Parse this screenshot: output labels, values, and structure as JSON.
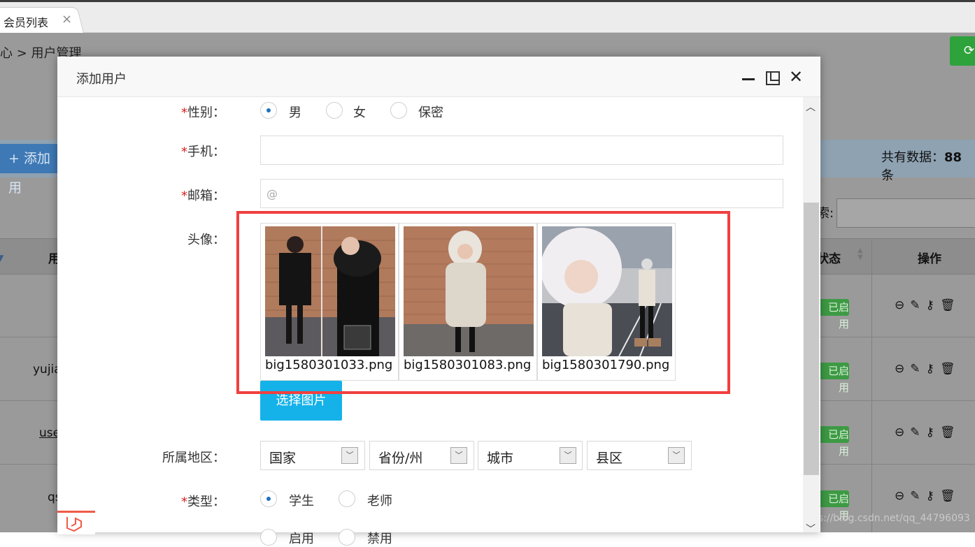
{
  "tab": {
    "label": "会员列表",
    "close": "×"
  },
  "breadcrumb": "心 > 用户管理",
  "toolbar": {
    "add_label": "+ 添加用",
    "total_prefix": "共有数据：",
    "total_count": "88",
    "total_suffix": " 条",
    "search_label": "索:"
  },
  "table": {
    "headers": {
      "user": "用",
      "status": "状态",
      "actions": "操作"
    },
    "rows": [
      {
        "name": "",
        "status": "已启用"
      },
      {
        "name": "yujia",
        "status": "已启用"
      },
      {
        "name": "use",
        "status": "已启用"
      },
      {
        "name": "qs",
        "status": "已启用"
      }
    ],
    "action_icons": [
      "stop-icon",
      "edit-icon",
      "key-icon",
      "trash-icon"
    ]
  },
  "watermark": "https://blog.csdn.net/qq_44796093",
  "modal": {
    "title": "添加用户",
    "gender": {
      "label": "性别：",
      "options": [
        "男",
        "女",
        "保密"
      ],
      "selected": "男"
    },
    "phone": {
      "label": "手机：",
      "value": ""
    },
    "email": {
      "label": "邮箱：",
      "placeholder": "@"
    },
    "avatar": {
      "label": "头像：",
      "files": [
        "big1580301033.png",
        "big1580301083.png",
        "big1580301790.png"
      ],
      "button": "选择图片"
    },
    "region": {
      "label": "所属地区：",
      "selects": [
        "国家",
        "省份/州",
        "城市",
        "县区"
      ]
    },
    "type": {
      "label": "类型：",
      "options": [
        "学生",
        "老师"
      ],
      "selected": "学生"
    },
    "status_cut": {
      "options": [
        "启用",
        "禁用"
      ]
    }
  },
  "colors": {
    "accent": "#15b2e9",
    "highlight": "#f04040",
    "radio": "#1e72bd",
    "success": "#3d9a44"
  }
}
